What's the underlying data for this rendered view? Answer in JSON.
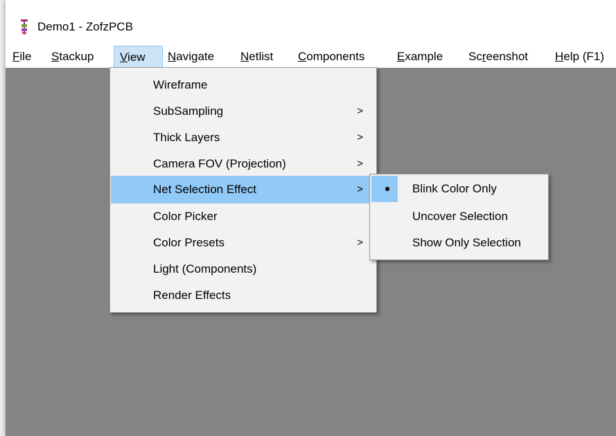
{
  "window": {
    "title": "Demo1 - ZofzPCB",
    "icon": "zofzpcb-app-icon"
  },
  "menubar": {
    "items": [
      {
        "label": "File",
        "mnemonic": "F",
        "rest": "ile"
      },
      {
        "label": "Stackup",
        "mnemonic": "S",
        "rest": "tackup"
      },
      {
        "label": "View",
        "mnemonic": "V",
        "rest": "iew",
        "active": true
      },
      {
        "label": "Navigate",
        "mnemonic": "N",
        "rest": "avigate"
      },
      {
        "label": "Netlist",
        "mnemonic": "N",
        "rest": "etlist"
      },
      {
        "label": "Components",
        "mnemonic": "C",
        "rest": "omponents"
      },
      {
        "label": "Example",
        "mnemonic": "E",
        "rest": "xample"
      },
      {
        "label": "Screenshot",
        "pre": "Sc",
        "mnemonic": "r",
        "rest": "eenshot"
      },
      {
        "label": "Help (F1)",
        "mnemonic": "H",
        "rest": "elp (F1)"
      }
    ]
  },
  "view_menu": {
    "items": [
      {
        "label": "Wireframe",
        "submenu": false
      },
      {
        "label": "SubSampling",
        "submenu": true
      },
      {
        "label": "Thick Layers",
        "submenu": true
      },
      {
        "label": "Camera FOV (Projection)",
        "submenu": true
      },
      {
        "label": "Net Selection Effect",
        "submenu": true,
        "highlighted": true
      },
      {
        "label": "Color Picker",
        "submenu": false
      },
      {
        "label": "Color Presets",
        "submenu": true
      },
      {
        "label": "Light (Components)",
        "submenu": false
      },
      {
        "label": "Render Effects",
        "submenu": false
      }
    ],
    "submenu_arrow": ">"
  },
  "net_selection_submenu": {
    "items": [
      {
        "label": "Blink Color Only",
        "selected": true,
        "highlighted": true
      },
      {
        "label": "Uncover Selection",
        "selected": false
      },
      {
        "label": "Show Only Selection",
        "selected": false
      }
    ]
  },
  "colors": {
    "client_background": "#848484",
    "highlight": "#91c9f7",
    "menu_background": "#f2f2f2",
    "active_menubar_item": "#cce4f7"
  }
}
